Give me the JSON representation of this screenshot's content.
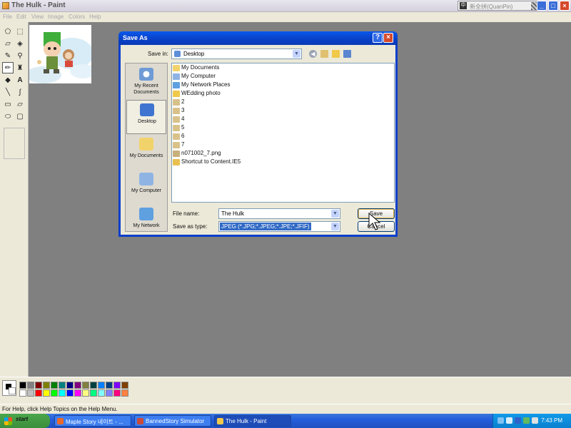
{
  "window": {
    "title": "The Hulk - Paint",
    "ime_text": "新全拼(QuanPin)"
  },
  "menu": [
    "File",
    "Edit",
    "View",
    "Image",
    "Colors",
    "Help"
  ],
  "toolbox": {
    "tools": [
      "free-form-select",
      "select",
      "eraser",
      "fill",
      "color-picker",
      "magnifier",
      "pencil",
      "brush",
      "airbrush",
      "text",
      "line",
      "curve",
      "rectangle",
      "polygon",
      "ellipse",
      "rounded-rectangle"
    ],
    "active_tool": "pencil"
  },
  "palette": {
    "colors_top": [
      "#000000",
      "#808080",
      "#800000",
      "#808000",
      "#008000",
      "#008080",
      "#000080",
      "#800080",
      "#808040",
      "#004040",
      "#0080ff",
      "#004080",
      "#8000ff",
      "#804000"
    ],
    "colors_bottom": [
      "#ffffff",
      "#c0c0c0",
      "#ff0000",
      "#ffff00",
      "#00ff00",
      "#00ffff",
      "#0000ff",
      "#ff00ff",
      "#ffff80",
      "#00ff80",
      "#80ffff",
      "#8080ff",
      "#ff0080",
      "#ff8040"
    ]
  },
  "status": {
    "text": "For Help, click Help Topics on the Help Menu."
  },
  "dialog": {
    "title": "Save As",
    "save_in_label": "Save in:",
    "save_in_value": "Desktop",
    "places": [
      "My Recent Documents",
      "Desktop",
      "My Documents",
      "My Computer",
      "My Network"
    ],
    "active_place": "Desktop",
    "files": [
      {
        "name": "My Documents",
        "icon": "my-documents-icon"
      },
      {
        "name": "My Computer",
        "icon": "my-computer-icon"
      },
      {
        "name": "My Network Places",
        "icon": "network-places-icon"
      },
      {
        "name": "WEdding photo",
        "icon": "folder-icon"
      },
      {
        "name": "2",
        "icon": "jpeg-file-icon"
      },
      {
        "name": "3",
        "icon": "jpeg-file-icon"
      },
      {
        "name": "4",
        "icon": "jpeg-file-icon"
      },
      {
        "name": "5",
        "icon": "jpeg-file-icon"
      },
      {
        "name": "6",
        "icon": "jpeg-file-icon"
      },
      {
        "name": "7",
        "icon": "jpeg-file-icon"
      },
      {
        "name": "n071002_7.png",
        "icon": "png-file-icon"
      },
      {
        "name": "Shortcut to Content.IE5",
        "icon": "shortcut-folder-icon"
      }
    ],
    "file_name_label": "File name:",
    "file_name_value": "The Hulk",
    "save_type_label": "Save as type:",
    "save_type_value": "JPEG (*.JPG;*.JPEG;*.JPE;*.JFIF)",
    "save_button": "Save",
    "cancel_button": "Cancel"
  },
  "taskbar": {
    "start": "start",
    "tasks": [
      {
        "label": "Maple Story 네이트 - ...",
        "active": false
      },
      {
        "label": "BannedStory Simulator",
        "active": false
      },
      {
        "label": "The Hulk - Paint",
        "active": true
      }
    ],
    "clock": "7:43 PM"
  }
}
